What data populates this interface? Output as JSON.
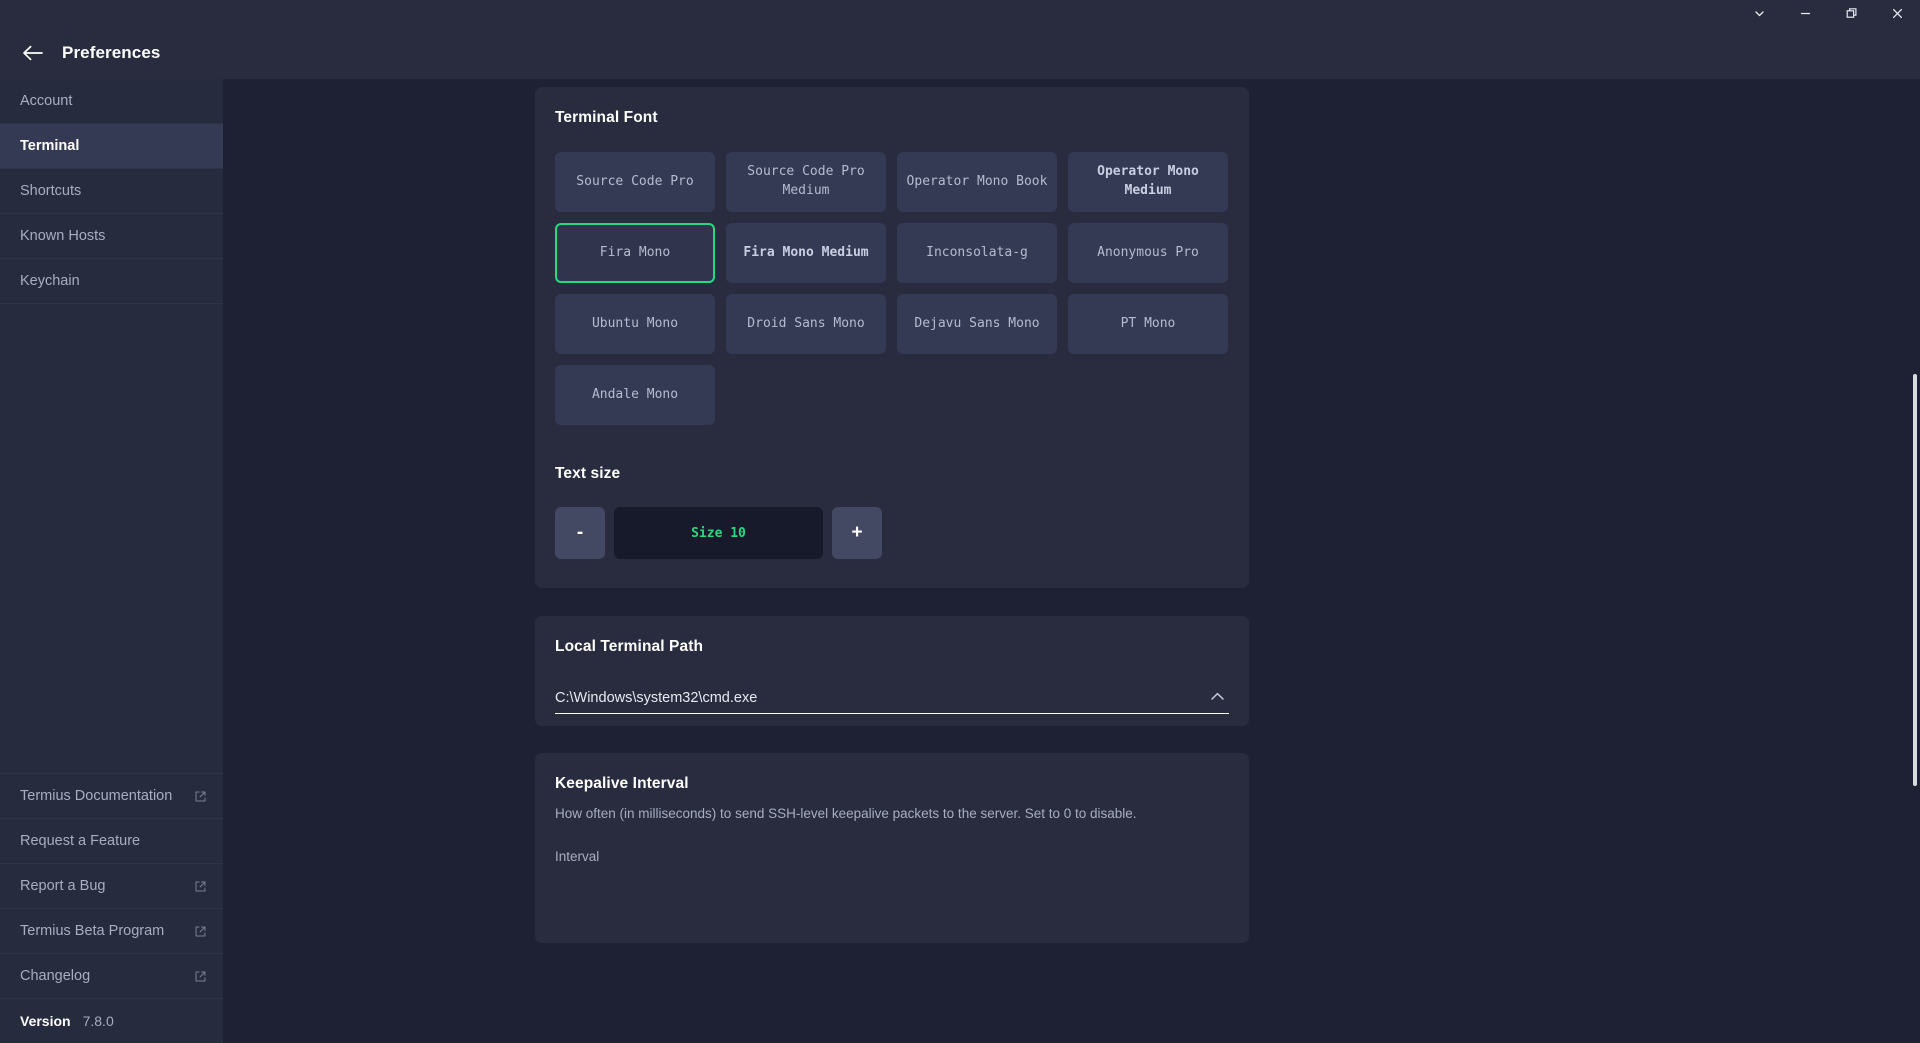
{
  "window": {
    "controls": [
      {
        "name": "chevron-down",
        "label": "Minimize to tray"
      },
      {
        "name": "minimize",
        "label": "Minimize"
      },
      {
        "name": "restore",
        "label": "Restore"
      },
      {
        "name": "close",
        "label": "Close"
      }
    ]
  },
  "header": {
    "title": "Preferences",
    "back_icon": "arrow-left-icon"
  },
  "sidebar": {
    "top_items": [
      {
        "label": "Account",
        "active": false,
        "external": false
      },
      {
        "label": "Terminal",
        "active": true,
        "external": false
      },
      {
        "label": "Shortcuts",
        "active": false,
        "external": false
      },
      {
        "label": "Known Hosts",
        "active": false,
        "external": false
      },
      {
        "label": "Keychain",
        "active": false,
        "external": false
      }
    ],
    "bottom_items": [
      {
        "label": "Termius Documentation",
        "active": false,
        "external": true
      },
      {
        "label": "Request a Feature",
        "active": false,
        "external": false
      },
      {
        "label": "Report a Bug",
        "active": false,
        "external": true
      },
      {
        "label": "Termius Beta Program",
        "active": false,
        "external": true
      },
      {
        "label": "Changelog",
        "active": false,
        "external": true
      }
    ],
    "version": {
      "label": "Version",
      "value": "7.8.0"
    }
  },
  "main": {
    "terminal_font": {
      "title": "Terminal Font",
      "selected": "Fira Mono",
      "tiles": [
        {
          "label": "Source Code Pro",
          "bold": false
        },
        {
          "label": "Source Code Pro Medium",
          "bold": false
        },
        {
          "label": "Operator Mono Book",
          "bold": false
        },
        {
          "label": "Operator Mono Medium",
          "bold": true
        },
        {
          "label": "Fira Mono",
          "bold": false
        },
        {
          "label": "Fira Mono Medium",
          "bold": true
        },
        {
          "label": "Inconsolata-g",
          "bold": false
        },
        {
          "label": "Anonymous Pro",
          "bold": false
        },
        {
          "label": "Ubuntu Mono",
          "bold": false
        },
        {
          "label": "Droid Sans Mono",
          "bold": false
        },
        {
          "label": "Dejavu Sans Mono",
          "bold": false
        },
        {
          "label": "PT Mono",
          "bold": false
        },
        {
          "label": "Andale Mono",
          "bold": false
        }
      ]
    },
    "text_size": {
      "title": "Text size",
      "decrement_label": "-",
      "increment_label": "+",
      "value_label": "Size 10",
      "accent_color": "#2ad97f"
    },
    "local_terminal_path": {
      "title": "Local Terminal Path",
      "value": "C:\\Windows\\system32\\cmd.exe",
      "placeholder": "Local Terminal Path",
      "chevron_icon": "chevron-up-icon"
    },
    "keepalive": {
      "title": "Keepalive Interval",
      "description": "How often (in milliseconds) to send SSH-level keepalive packets to the server. Set to 0 to disable.",
      "field_label": "Interval"
    }
  }
}
